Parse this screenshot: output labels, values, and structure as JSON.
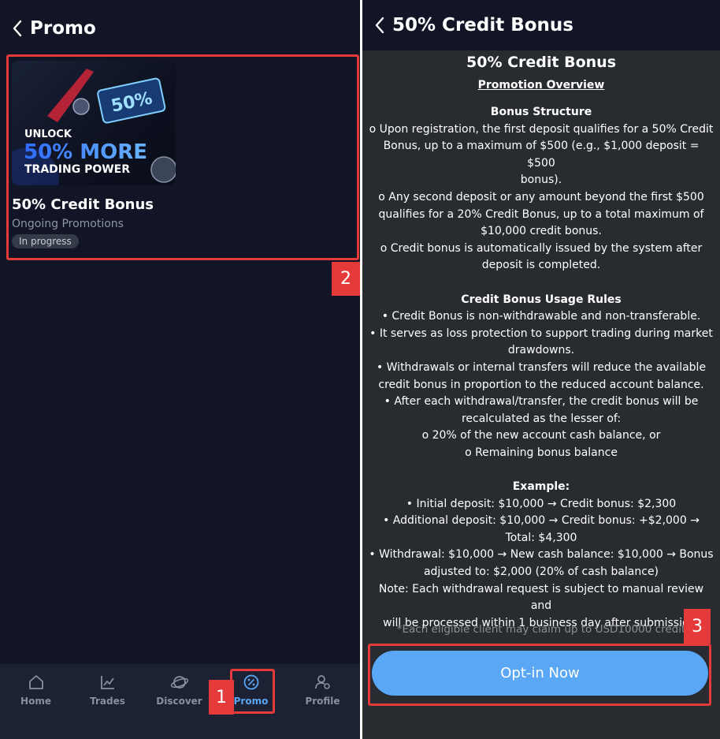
{
  "left": {
    "title": "Promo",
    "card": {
      "image_lines": [
        "UNLOCK",
        "50% MORE",
        "TRADING POWER"
      ],
      "image_ticket_text": "50%",
      "title": "50% Credit Bonus",
      "subtitle": "Ongoing Promotions",
      "status": "In progress"
    }
  },
  "nav": {
    "items": [
      {
        "label": "Home",
        "icon": "home-icon"
      },
      {
        "label": "Trades",
        "icon": "chart-icon"
      },
      {
        "label": "Discover",
        "icon": "planet-icon"
      },
      {
        "label": "Promo",
        "icon": "percent-badge-icon"
      },
      {
        "label": "Profile",
        "icon": "user-settings-icon"
      }
    ],
    "active": "Promo"
  },
  "right": {
    "title": "50% Credit Bonus",
    "content_title": "50% Credit Bonus",
    "overview": "Promotion Overview",
    "bonus_structure": {
      "heading": "Bonus Structure",
      "lines": [
        "o Upon registration, the first deposit qualifies for a 50% Credit",
        "Bonus, up to a maximum of $500 (e.g., $1,000 deposit = $500",
        "bonus).",
        "o Any second deposit or any amount beyond the first $500",
        "qualifies for a 20% Credit Bonus, up to a total maximum of",
        "$10,000 credit bonus.",
        "o Credit bonus is automatically issued by the system after",
        "deposit is completed."
      ]
    },
    "usage_rules": {
      "heading": "Credit Bonus Usage Rules",
      "lines": [
        "• Credit Bonus is non-withdrawable and non-transferable.",
        "• It serves as loss protection to support trading during market",
        "drawdowns.",
        "• Withdrawals or internal transfers will reduce the available",
        "credit bonus in proportion to the reduced account balance.",
        "• After each withdrawal/transfer, the credit bonus will be",
        "recalculated as the lesser of:",
        "o 20% of the new account cash balance, or",
        "o Remaining bonus balance"
      ]
    },
    "example": {
      "heading": "Example:",
      "lines": [
        "• Initial deposit: $10,000 → Credit bonus: $2,300",
        "• Additional deposit: $10,000 → Credit bonus: +$2,000 →",
        "Total: $4,300",
        "• Withdrawal: $10,000 → New cash balance: $10,000 → Bonus",
        "adjusted to: $2,000 (20% of cash balance)",
        "Note: Each withdrawal request is subject to manual review and",
        "will be processed within 1 business day after submission."
      ]
    },
    "footnote": "*Each eligible client may claim up to USD10000 credit",
    "optin_label": "Opt-in Now"
  },
  "annotations": [
    "1",
    "2",
    "3"
  ],
  "colors": {
    "left_bg": "#111526",
    "right_bg": "#282b30",
    "nav_bg": "#1c2134",
    "accent": "#5aa7f5",
    "annotation": "#e53a3a"
  }
}
